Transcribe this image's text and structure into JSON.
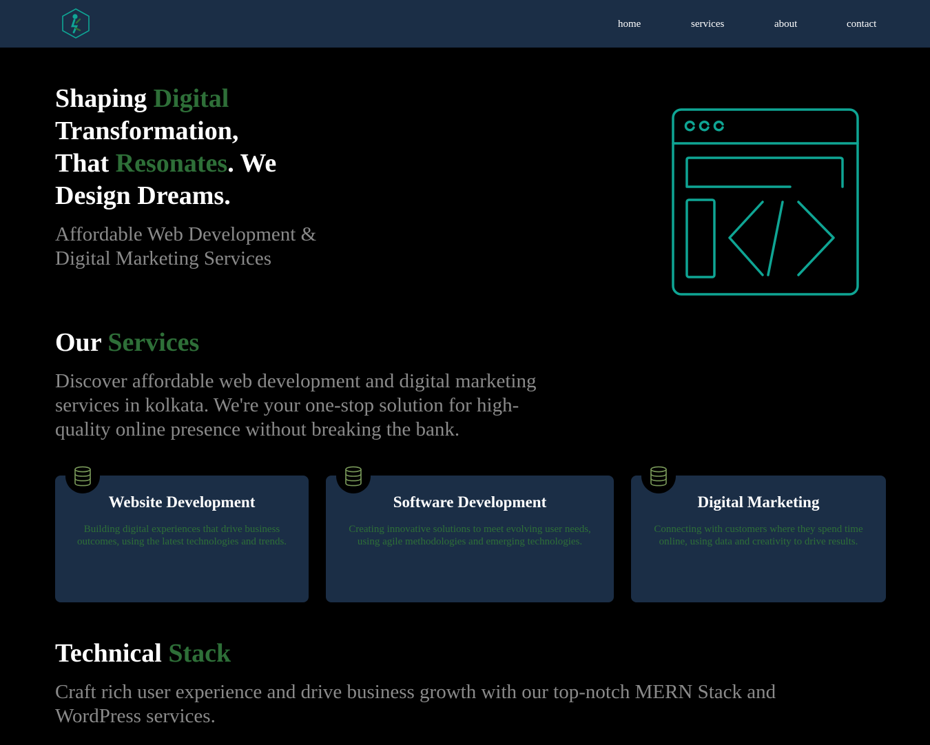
{
  "navbar": {
    "logo_icon": "hexagon-person-logo-icon",
    "links": [
      {
        "label": "home"
      },
      {
        "label": "services"
      },
      {
        "label": "about"
      },
      {
        "label": "contact"
      }
    ]
  },
  "hero": {
    "title_part1": "Shaping ",
    "title_accent1": "Digital",
    "title_part2": "Transformation,",
    "title_part3": "That ",
    "title_accent2": "Resonates",
    "title_part4": ". We",
    "title_part5": "Design Dreams.",
    "subtitle": "Affordable Web Development & Digital Marketing Services",
    "illustration_icon": "code-browser-icon"
  },
  "services": {
    "title_main": "Our ",
    "title_accent": "Services",
    "description": "Discover affordable web development and digital marketing services in kolkata. We're your one-stop solution for high-quality online presence without breaking the bank.",
    "cards": [
      {
        "icon": "database-icon",
        "title": "Website Development",
        "description": "Building digital experiences that drive business outcomes, using the latest technologies and trends."
      },
      {
        "icon": "database-icon",
        "title": "Software Development",
        "description": "Creating innovative solutions to meet evolving user needs, using agile methodologies and emerging technologies."
      },
      {
        "icon": "database-icon",
        "title": "Digital Marketing",
        "description": "Connecting with customers where they spend time online, using data and creativity to drive results."
      }
    ]
  },
  "stack": {
    "title_main": "Technical ",
    "title_accent": "Stack",
    "description": "Craft rich user experience and drive business growth with our top-notch MERN Stack and WordPress services."
  },
  "colors": {
    "navbar_bg": "#1b2e46",
    "page_bg": "#000000",
    "accent_green": "#2e6f38",
    "illustration_teal": "#0fa594",
    "muted_text": "#8a8a8a"
  }
}
